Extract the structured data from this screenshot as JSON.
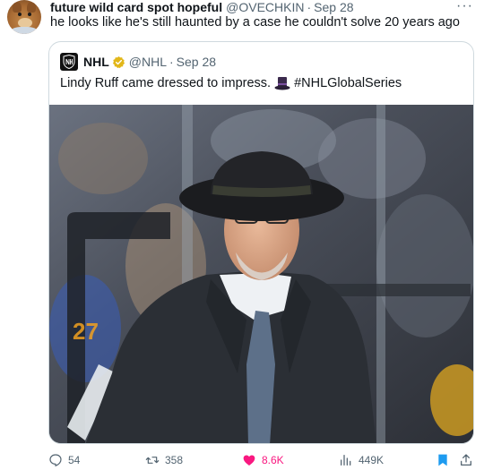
{
  "tweet": {
    "display_name": "future wild card spot hopeful",
    "handle": "@OVECHKIN",
    "separator": "·",
    "date": "Sep 28",
    "more": "···",
    "text": "he looks like he's still haunted by a case he couldn't solve 20 years ago"
  },
  "quote": {
    "display_name": "NHL",
    "handle": "@NHL",
    "separator": "·",
    "date": "Sep 28",
    "text": "Lindy Ruff came dressed to impress.",
    "hashtag": "#NHLGlobalSeries"
  },
  "actions": {
    "replies": "54",
    "retweets": "358",
    "likes": "8.6K",
    "views": "449K"
  },
  "colors": {
    "like_active": "#f91880",
    "bookmark_active": "#1d9bf0",
    "verified": "#e2b719"
  }
}
